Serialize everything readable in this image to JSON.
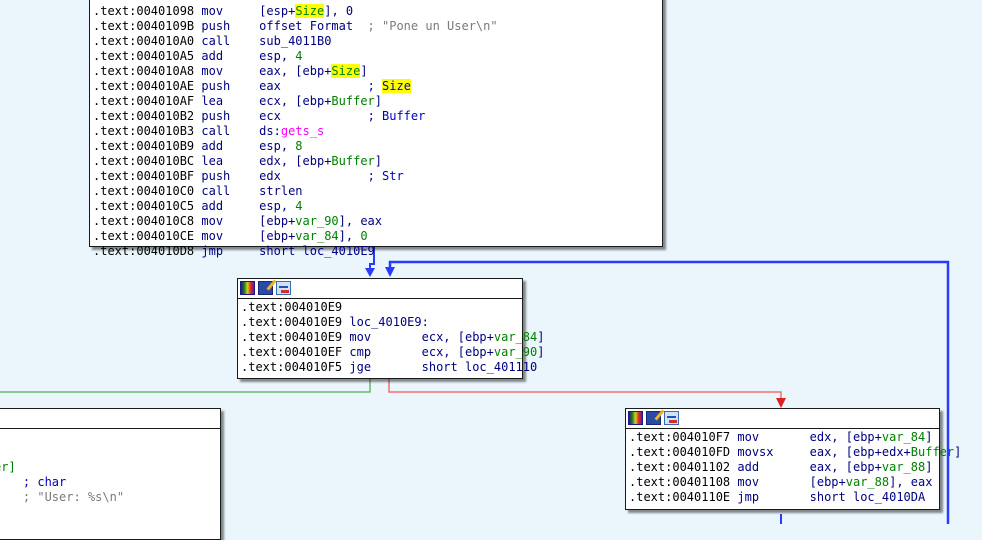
{
  "app": "IDA graph view",
  "colors": {
    "background": "#eaf6fc",
    "edge_unconditional": "#2a3aff",
    "edge_true": "#6ab86a",
    "edge_false": "#f07070",
    "highlight": "#ffff00"
  },
  "header_icons": [
    "color-palette-icon",
    "edit-block-icon",
    "graph-overview-icon"
  ],
  "blocks": {
    "top": {
      "lines": [
        {
          "addr": ".text:0040109B",
          "mn": "push",
          "op": "offset Format",
          "cmt": "; \"Pone un User\\n\""
        },
        {
          "addr": ".text:004010A0",
          "mn": "call",
          "op": "sub_4011B0"
        },
        {
          "addr": ".text:004010A5",
          "mn": "add",
          "op": "esp, ",
          "num": "4"
        },
        {
          "addr": ".text:004010A8",
          "mn": "mov",
          "op": "eax, [ebp+",
          "var": "Size",
          "tail": "]"
        },
        {
          "addr": ".text:004010AE",
          "mn": "push",
          "op": "eax",
          "cmt": "; ",
          "cmtvar": "Size"
        },
        {
          "addr": ".text:004010AF",
          "mn": "lea",
          "op": "ecx, [ebp+",
          "var": "Buffer",
          "tail": "]"
        },
        {
          "addr": ".text:004010B2",
          "mn": "push",
          "op": "ecx",
          "cmt": "; Buffer"
        },
        {
          "addr": ".text:004010B3",
          "mn": "call",
          "op": "ds:",
          "imp": "gets_s"
        },
        {
          "addr": ".text:004010B9",
          "mn": "add",
          "op": "esp, ",
          "num": "8"
        },
        {
          "addr": ".text:004010BC",
          "mn": "lea",
          "op": "edx, [ebp+",
          "var": "Buffer",
          "tail": "]"
        },
        {
          "addr": ".text:004010BF",
          "mn": "push",
          "op": "edx",
          "cmt": "; Str"
        },
        {
          "addr": ".text:004010C0",
          "mn": "call",
          "op": "strlen"
        },
        {
          "addr": ".text:004010C5",
          "mn": "add",
          "op": "esp, ",
          "num": "4"
        },
        {
          "addr": ".text:004010C8",
          "mn": "mov",
          "op": "[ebp+",
          "var": "var_90",
          "tail": "], eax"
        },
        {
          "addr": ".text:004010CE",
          "mn": "mov",
          "op": "[ebp+",
          "var": "var_84",
          "tail": "], ",
          "num": "0"
        },
        {
          "addr": ".text:004010D8",
          "mn": "jmp",
          "op": "short loc_4010E9"
        }
      ]
    },
    "loop_check": {
      "lines": [
        {
          "addr": ".text:004010E9"
        },
        {
          "addr": ".text:004010E9",
          "label": "loc_4010E9:"
        },
        {
          "addr": ".text:004010E9",
          "mn": "mov",
          "op": "ecx, [ebp+",
          "var": "var_84",
          "tail": "]"
        },
        {
          "addr": ".text:004010EF",
          "mn": "cmp",
          "op": "ecx, [ebp+",
          "var": "var_90",
          "tail": "]"
        },
        {
          "addr": ".text:004010F5",
          "mn": "jge",
          "op": "short loc_401110"
        }
      ]
    },
    "loop_body": {
      "lines": [
        {
          "addr": ".text:004010F7",
          "mn": "mov",
          "op": "edx, [ebp+",
          "var": "var_84",
          "tail": "]"
        },
        {
          "addr": ".text:004010FD",
          "mn": "movsx",
          "op": "eax, [ebp+edx+",
          "var": "Buffer",
          "tail": "]"
        },
        {
          "addr": ".text:00401102",
          "mn": "add",
          "op": "eax, [ebp+",
          "var": "var_88",
          "tail": "]"
        },
        {
          "addr": ".text:00401108",
          "mn": "mov",
          "op": "[ebp+",
          "var": "var_88",
          "tail": "], eax"
        },
        {
          "addr": ".text:0040110E",
          "mn": "jmp",
          "op": "short loc_4010DA"
        }
      ]
    },
    "exit_partial": {
      "lines": [
        {
          "frag": "er]"
        },
        {
          "cmt_blue": "; char"
        },
        {
          "cmt": "; \"User: %s\\n\""
        }
      ]
    }
  }
}
